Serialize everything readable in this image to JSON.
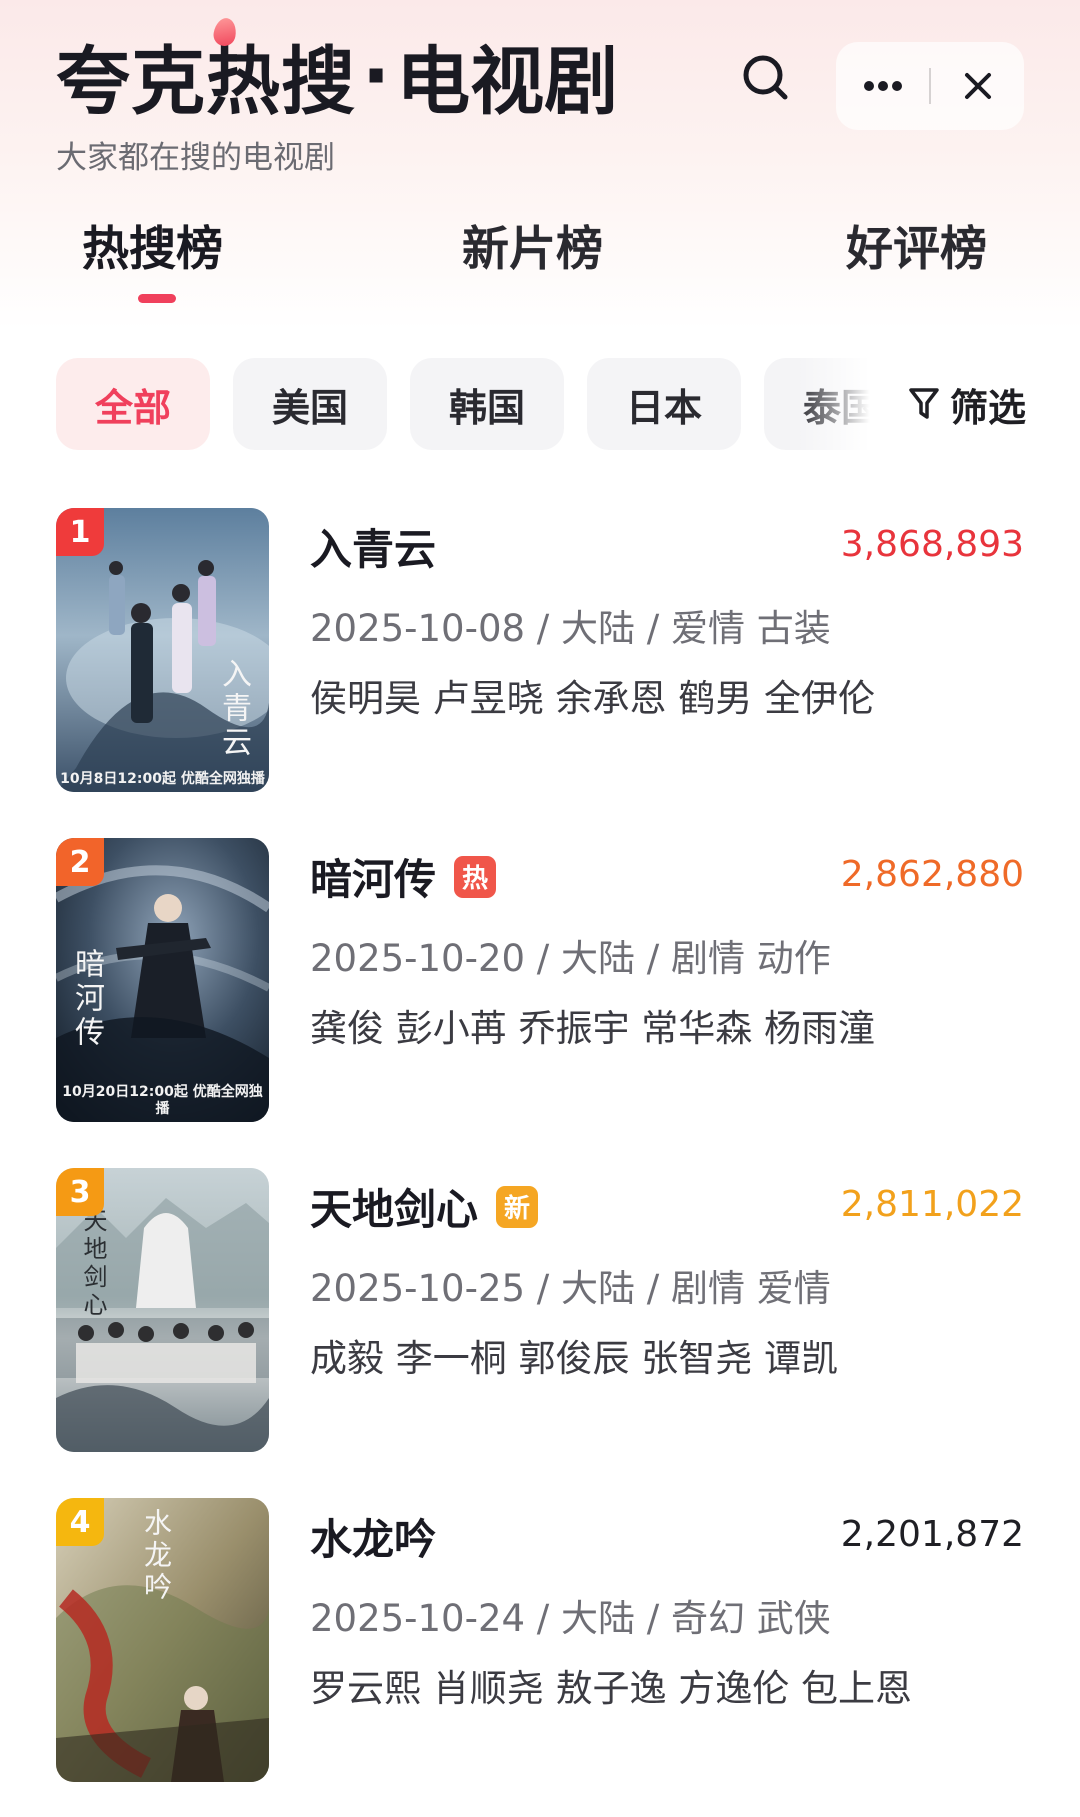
{
  "header": {
    "brand": "夸克热搜",
    "dot": "·",
    "section": "电视剧",
    "subtitle": "大家都在搜的电视剧"
  },
  "icons": {
    "search": "search-icon",
    "more": "more-icon",
    "close": "close-icon",
    "filter": "funnel-icon"
  },
  "tabs": [
    {
      "label": "热搜榜",
      "active": true
    },
    {
      "label": "新片榜",
      "active": false
    },
    {
      "label": "好评榜",
      "active": false
    }
  ],
  "chips": [
    {
      "label": "全部",
      "active": true
    },
    {
      "label": "美国",
      "active": false
    },
    {
      "label": "韩国",
      "active": false
    },
    {
      "label": "日本",
      "active": false
    },
    {
      "label": "泰国",
      "active": false
    }
  ],
  "filter_label": "筛选",
  "colors": {
    "accent": "#f0405c",
    "rank1": "#ef3b3b",
    "rank2": "#f2642a",
    "rank3": "#f59a14",
    "rank4": "#f5b70f",
    "heat1": "#e8343c",
    "heat2": "#ef6a28",
    "heat3": "#f2a11c",
    "heat4": "#1f1f24",
    "tag_hot": "#f0564a",
    "tag_new": "#f5a623"
  },
  "items": [
    {
      "rank": "1",
      "title": "入青云",
      "tag": "",
      "heat": "3,868,893",
      "meta": "2025-10-08 / 大陆 / 爱情 古装",
      "cast": "侯明昊 卢昱晓 余承恩 鹤男 全伊伦",
      "poster_text": "入青云",
      "poster_caption": "10月8日12:00起 优酷全网独播"
    },
    {
      "rank": "2",
      "title": "暗河传",
      "tag": "热",
      "heat": "2,862,880",
      "meta": "2025-10-20 / 大陆 / 剧情 动作",
      "cast": "龚俊 彭小苒 乔振宇 常华森 杨雨潼",
      "poster_text": "暗河传",
      "poster_caption": "10月20日12:00起 优酷全网独播"
    },
    {
      "rank": "3",
      "title": "天地剑心",
      "tag": "新",
      "heat": "2,811,022",
      "meta": "2025-10-25 / 大陆 / 剧情 爱情",
      "cast": "成毅 李一桐 郭俊辰 张智尧 谭凯",
      "poster_text": "天地剑心",
      "poster_caption": ""
    },
    {
      "rank": "4",
      "title": "水龙吟",
      "tag": "",
      "heat": "2,201,872",
      "meta": "2025-10-24 / 大陆 / 奇幻 武侠",
      "cast": "罗云熙 肖顺尧 敖子逸 方逸伦 包上恩",
      "poster_text": "水龙吟",
      "poster_caption": ""
    }
  ]
}
